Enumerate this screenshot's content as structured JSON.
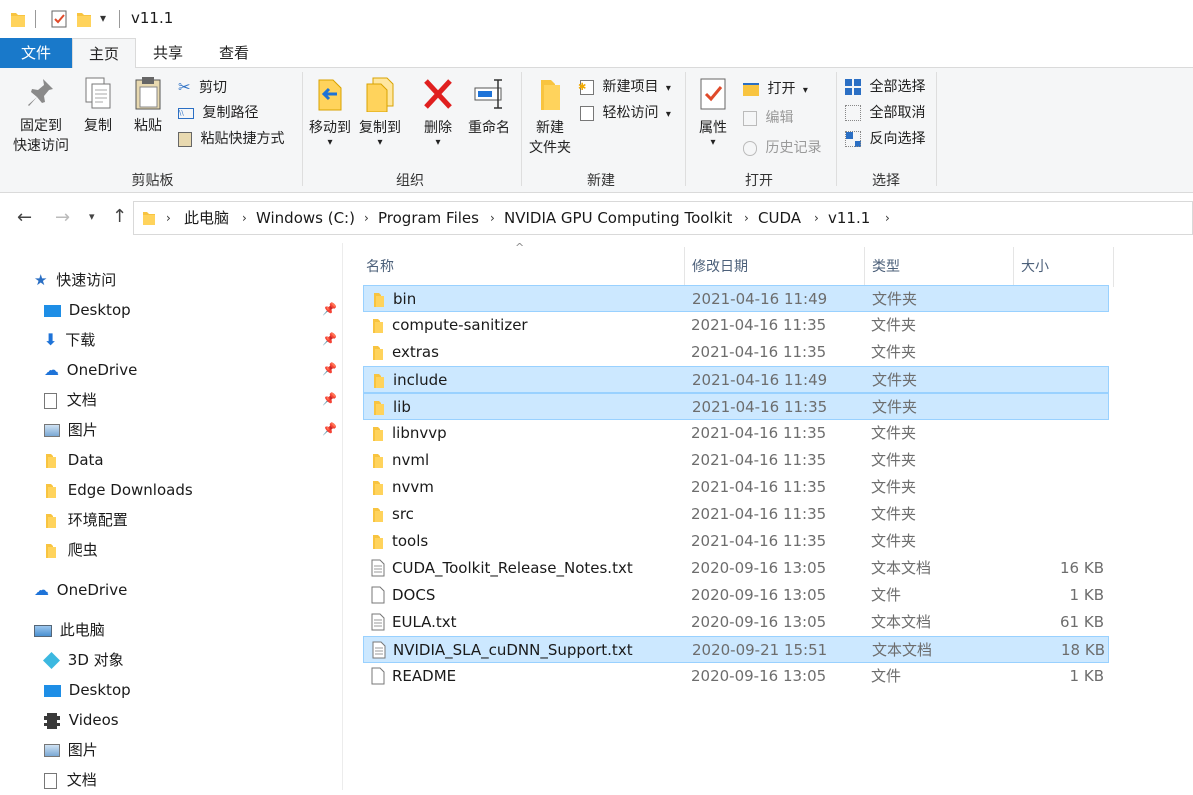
{
  "window": {
    "title": "v11.1"
  },
  "tabs": [
    {
      "label": "文件"
    },
    {
      "label": "主页"
    },
    {
      "label": "共享"
    },
    {
      "label": "查看"
    }
  ],
  "ribbon": {
    "clipboard": {
      "pin": "固定到\n快速访问",
      "pin_l1": "固定到",
      "pin_l2": "快速访问",
      "copy": "复制",
      "paste": "粘贴",
      "cut": "剪切",
      "copy_path": "复制路径",
      "paste_shortcut": "粘贴快捷方式",
      "label": "剪贴板"
    },
    "organize": {
      "move_to": "移动到",
      "copy_to": "复制到",
      "delete": "删除",
      "rename": "重命名",
      "label": "组织"
    },
    "new": {
      "new_folder_l1": "新建",
      "new_folder_l2": "文件夹",
      "new_item": "新建项目",
      "easy_access": "轻松访问",
      "label": "新建"
    },
    "open": {
      "properties": "属性",
      "open": "打开",
      "edit": "编辑",
      "history": "历史记录",
      "label": "打开"
    },
    "select": {
      "select_all": "全部选择",
      "select_none": "全部取消",
      "invert": "反向选择",
      "label": "选择"
    }
  },
  "address": {
    "crumbs": [
      "此电脑",
      "Windows (C:)",
      "Program Files",
      "NVIDIA GPU Computing Toolkit",
      "CUDA",
      "v11.1"
    ]
  },
  "nav": {
    "items": [
      {
        "label": "快速访问",
        "icon": "star-icon",
        "pinned": false
      },
      {
        "label": "Desktop",
        "icon": "desktop-icon",
        "pinned": true
      },
      {
        "label": "下载",
        "icon": "download-icon",
        "pinned": true
      },
      {
        "label": "OneDrive",
        "icon": "cloud-icon",
        "pinned": true
      },
      {
        "label": "文档",
        "icon": "document-icon",
        "pinned": true
      },
      {
        "label": "图片",
        "icon": "picture-icon",
        "pinned": true
      },
      {
        "label": "Data",
        "icon": "folder-icon",
        "pinned": false
      },
      {
        "label": "Edge Downloads",
        "icon": "folder-icon",
        "pinned": false
      },
      {
        "label": "环境配置",
        "icon": "folder-icon",
        "pinned": false
      },
      {
        "label": "爬虫",
        "icon": "folder-icon",
        "pinned": false
      },
      {
        "label": "OneDrive",
        "icon": "cloud-icon",
        "pinned": false
      },
      {
        "label": "此电脑",
        "icon": "computer-icon",
        "pinned": false
      },
      {
        "label": "3D 对象",
        "icon": "cube-icon",
        "pinned": false
      },
      {
        "label": "Desktop",
        "icon": "desktop-icon",
        "pinned": false
      },
      {
        "label": "Videos",
        "icon": "video-icon",
        "pinned": false
      },
      {
        "label": "图片",
        "icon": "picture-icon",
        "pinned": false
      },
      {
        "label": "文档",
        "icon": "document-icon",
        "pinned": false
      }
    ]
  },
  "list": {
    "columns": {
      "name": "名称",
      "date": "修改日期",
      "type": "类型",
      "size": "大小"
    },
    "files": [
      {
        "name": "bin",
        "date": "2021-04-16 11:49",
        "type": "文件夹",
        "size": "",
        "kind": "folder",
        "selected": true
      },
      {
        "name": "compute-sanitizer",
        "date": "2021-04-16 11:35",
        "type": "文件夹",
        "size": "",
        "kind": "folder",
        "selected": false
      },
      {
        "name": "extras",
        "date": "2021-04-16 11:35",
        "type": "文件夹",
        "size": "",
        "kind": "folder",
        "selected": false
      },
      {
        "name": "include",
        "date": "2021-04-16 11:49",
        "type": "文件夹",
        "size": "",
        "kind": "folder",
        "selected": true
      },
      {
        "name": "lib",
        "date": "2021-04-16 11:35",
        "type": "文件夹",
        "size": "",
        "kind": "folder",
        "selected": true
      },
      {
        "name": "libnvvp",
        "date": "2021-04-16 11:35",
        "type": "文件夹",
        "size": "",
        "kind": "folder",
        "selected": false
      },
      {
        "name": "nvml",
        "date": "2021-04-16 11:35",
        "type": "文件夹",
        "size": "",
        "kind": "folder",
        "selected": false
      },
      {
        "name": "nvvm",
        "date": "2021-04-16 11:35",
        "type": "文件夹",
        "size": "",
        "kind": "folder",
        "selected": false
      },
      {
        "name": "src",
        "date": "2021-04-16 11:35",
        "type": "文件夹",
        "size": "",
        "kind": "folder",
        "selected": false
      },
      {
        "name": "tools",
        "date": "2021-04-16 11:35",
        "type": "文件夹",
        "size": "",
        "kind": "folder",
        "selected": false
      },
      {
        "name": "CUDA_Toolkit_Release_Notes.txt",
        "date": "2020-09-16 13:05",
        "type": "文本文档",
        "size": "16 KB",
        "kind": "textfile",
        "selected": false
      },
      {
        "name": "DOCS",
        "date": "2020-09-16 13:05",
        "type": "文件",
        "size": "1 KB",
        "kind": "file",
        "selected": false
      },
      {
        "name": "EULA.txt",
        "date": "2020-09-16 13:05",
        "type": "文本文档",
        "size": "61 KB",
        "kind": "textfile",
        "selected": false
      },
      {
        "name": "NVIDIA_SLA_cuDNN_Support.txt",
        "date": "2020-09-21 15:51",
        "type": "文本文档",
        "size": "18 KB",
        "kind": "textfile",
        "selected": true
      },
      {
        "name": "README",
        "date": "2020-09-16 13:05",
        "type": "文件",
        "size": "1 KB",
        "kind": "file",
        "selected": false
      }
    ]
  },
  "colors": {
    "accent": "#1979ca",
    "selection": "#cce8ff",
    "folder": "#f8c440"
  }
}
